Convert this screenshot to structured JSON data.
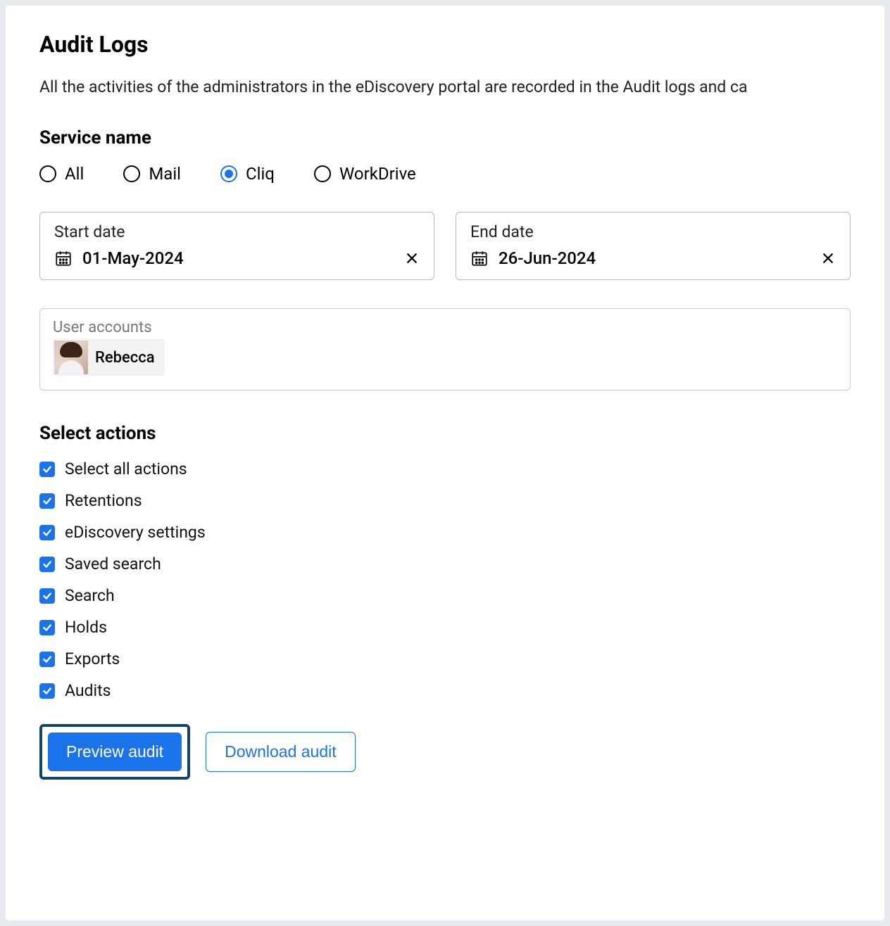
{
  "header": {
    "title": "Audit Logs",
    "description": "All the activities of the administrators in the eDiscovery portal are recorded in the Audit logs and ca"
  },
  "service": {
    "label": "Service name",
    "options": [
      {
        "label": "All",
        "selected": false
      },
      {
        "label": "Mail",
        "selected": false
      },
      {
        "label": "Cliq",
        "selected": true
      },
      {
        "label": "WorkDrive",
        "selected": false
      }
    ]
  },
  "dates": {
    "start": {
      "label": "Start date",
      "value": "01-May-2024"
    },
    "end": {
      "label": "End date",
      "value": "26-Jun-2024"
    }
  },
  "user_accounts": {
    "label": "User accounts",
    "chips": [
      {
        "name": "Rebecca"
      }
    ]
  },
  "actions": {
    "label": "Select actions",
    "items": [
      {
        "label": "Select all actions",
        "checked": true
      },
      {
        "label": "Retentions",
        "checked": true
      },
      {
        "label": "eDiscovery settings",
        "checked": true
      },
      {
        "label": "Saved search",
        "checked": true
      },
      {
        "label": "Search",
        "checked": true
      },
      {
        "label": "Holds",
        "checked": true
      },
      {
        "label": "Exports",
        "checked": true
      },
      {
        "label": "Audits",
        "checked": true
      }
    ]
  },
  "buttons": {
    "preview": "Preview audit",
    "download": "Download audit"
  }
}
